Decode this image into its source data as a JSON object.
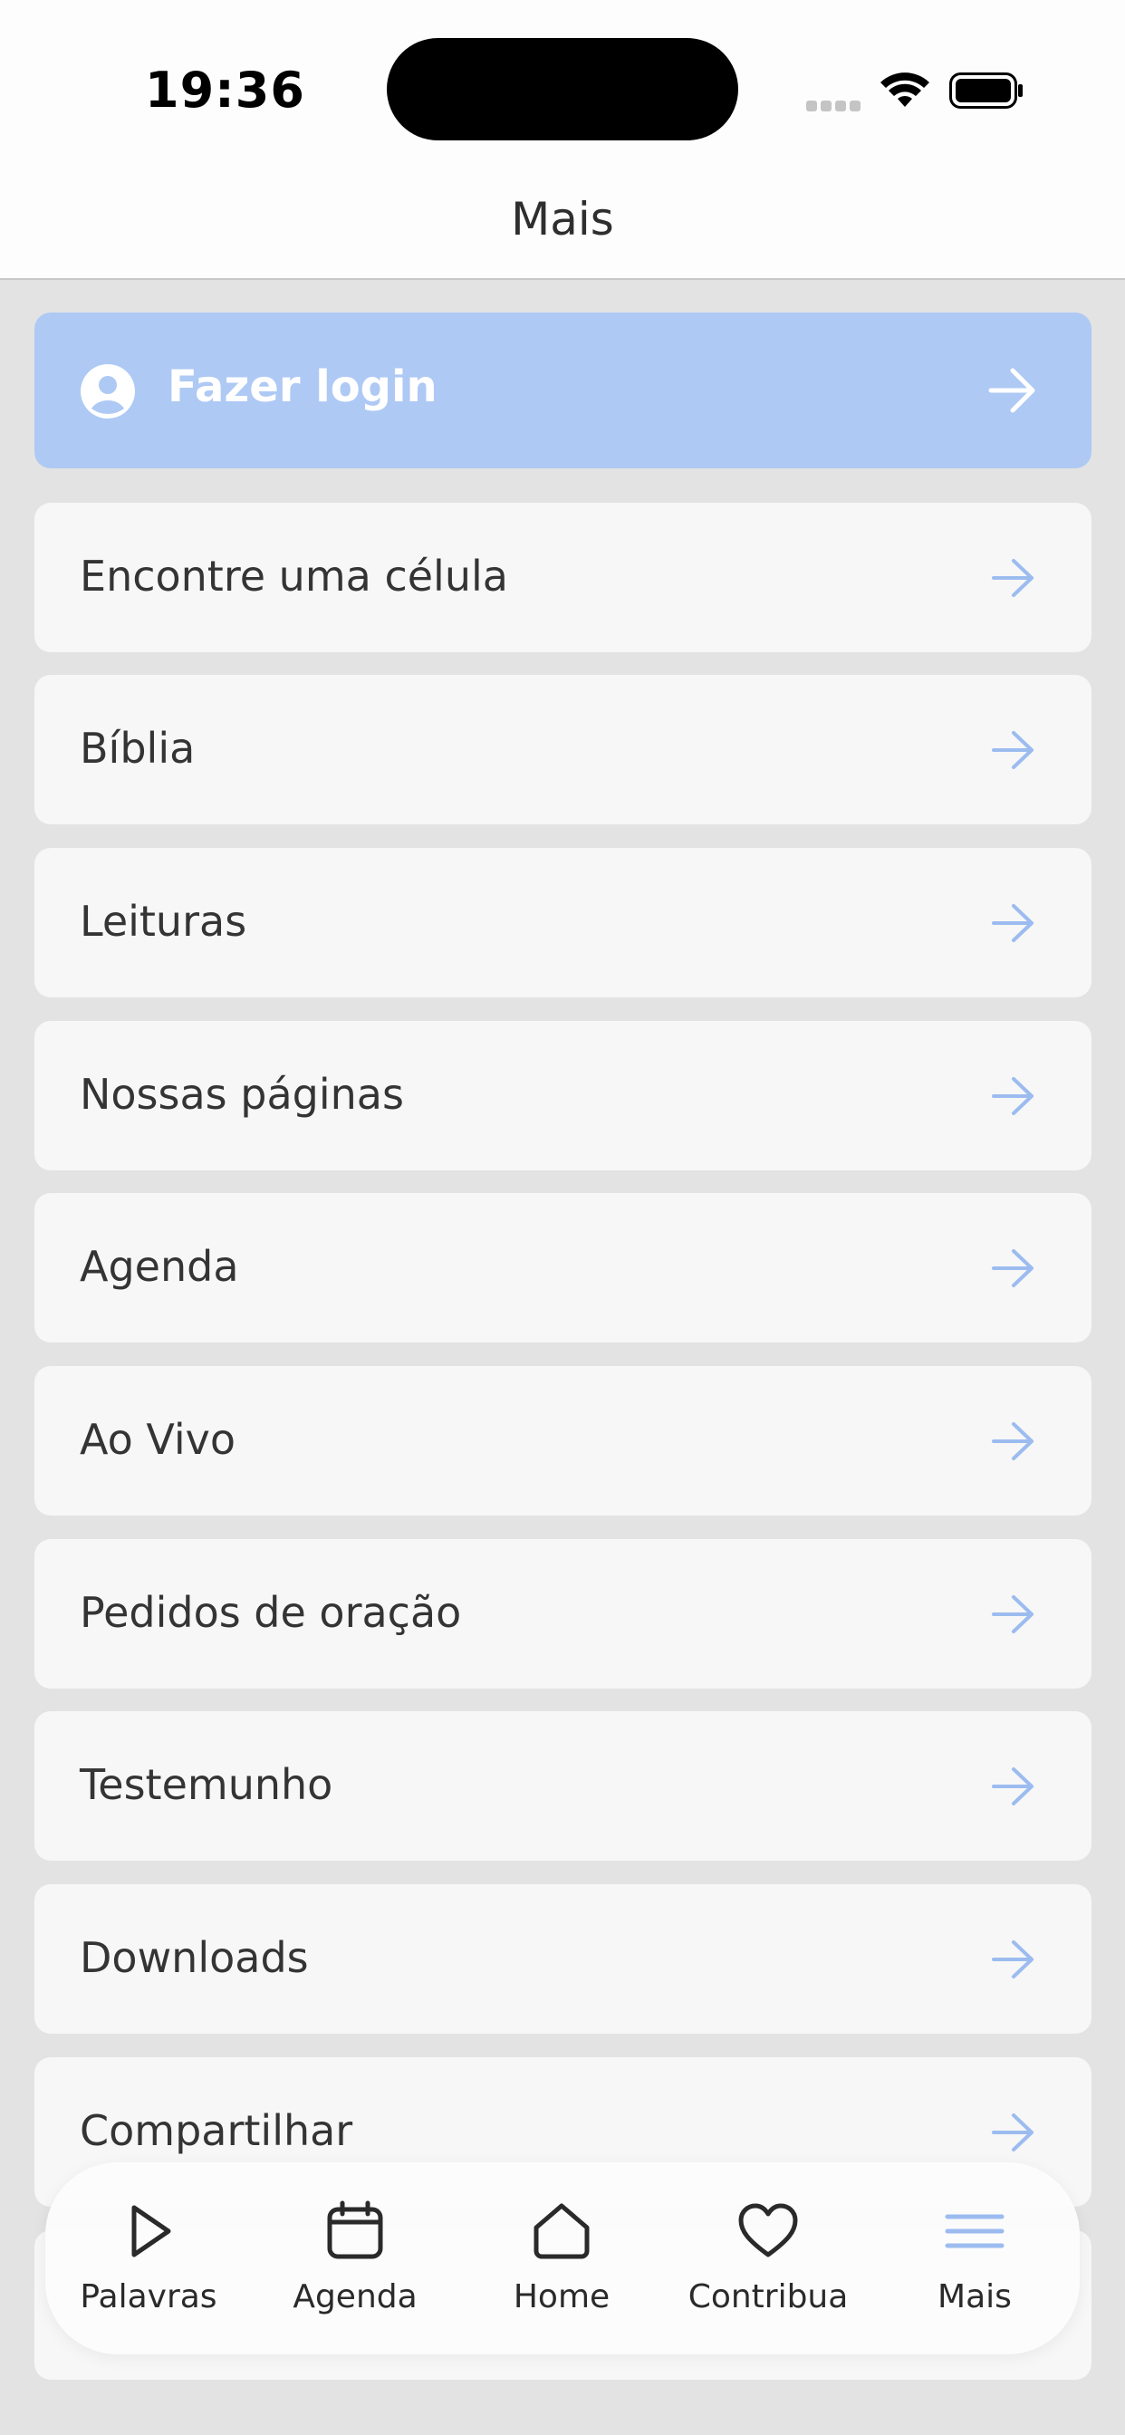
{
  "status_bar": {
    "time": "19:36"
  },
  "header": {
    "title": "Mais"
  },
  "login": {
    "label": "Fazer login"
  },
  "menu": {
    "items": [
      {
        "label": "Encontre uma célula"
      },
      {
        "label": "Bíblia"
      },
      {
        "label": "Leituras"
      },
      {
        "label": "Nossas páginas"
      },
      {
        "label": "Agenda"
      },
      {
        "label": "Ao Vivo"
      },
      {
        "label": "Pedidos de oração"
      },
      {
        "label": "Testemunho"
      },
      {
        "label": "Downloads"
      },
      {
        "label": "Compartilhar"
      }
    ]
  },
  "tab_bar": {
    "tabs": [
      {
        "label": "Palavras",
        "icon": "play-icon"
      },
      {
        "label": "Agenda",
        "icon": "calendar-icon"
      },
      {
        "label": "Home",
        "icon": "home-icon"
      },
      {
        "label": "Contribua",
        "icon": "heart-icon"
      },
      {
        "label": "Mais",
        "icon": "menu-icon",
        "active": true
      }
    ]
  },
  "colors": {
    "accent": "#aec9f4",
    "arrow": "#9cbcf0",
    "background": "#e3e3e3",
    "card": "#f7f7f7",
    "text": "#343434"
  }
}
